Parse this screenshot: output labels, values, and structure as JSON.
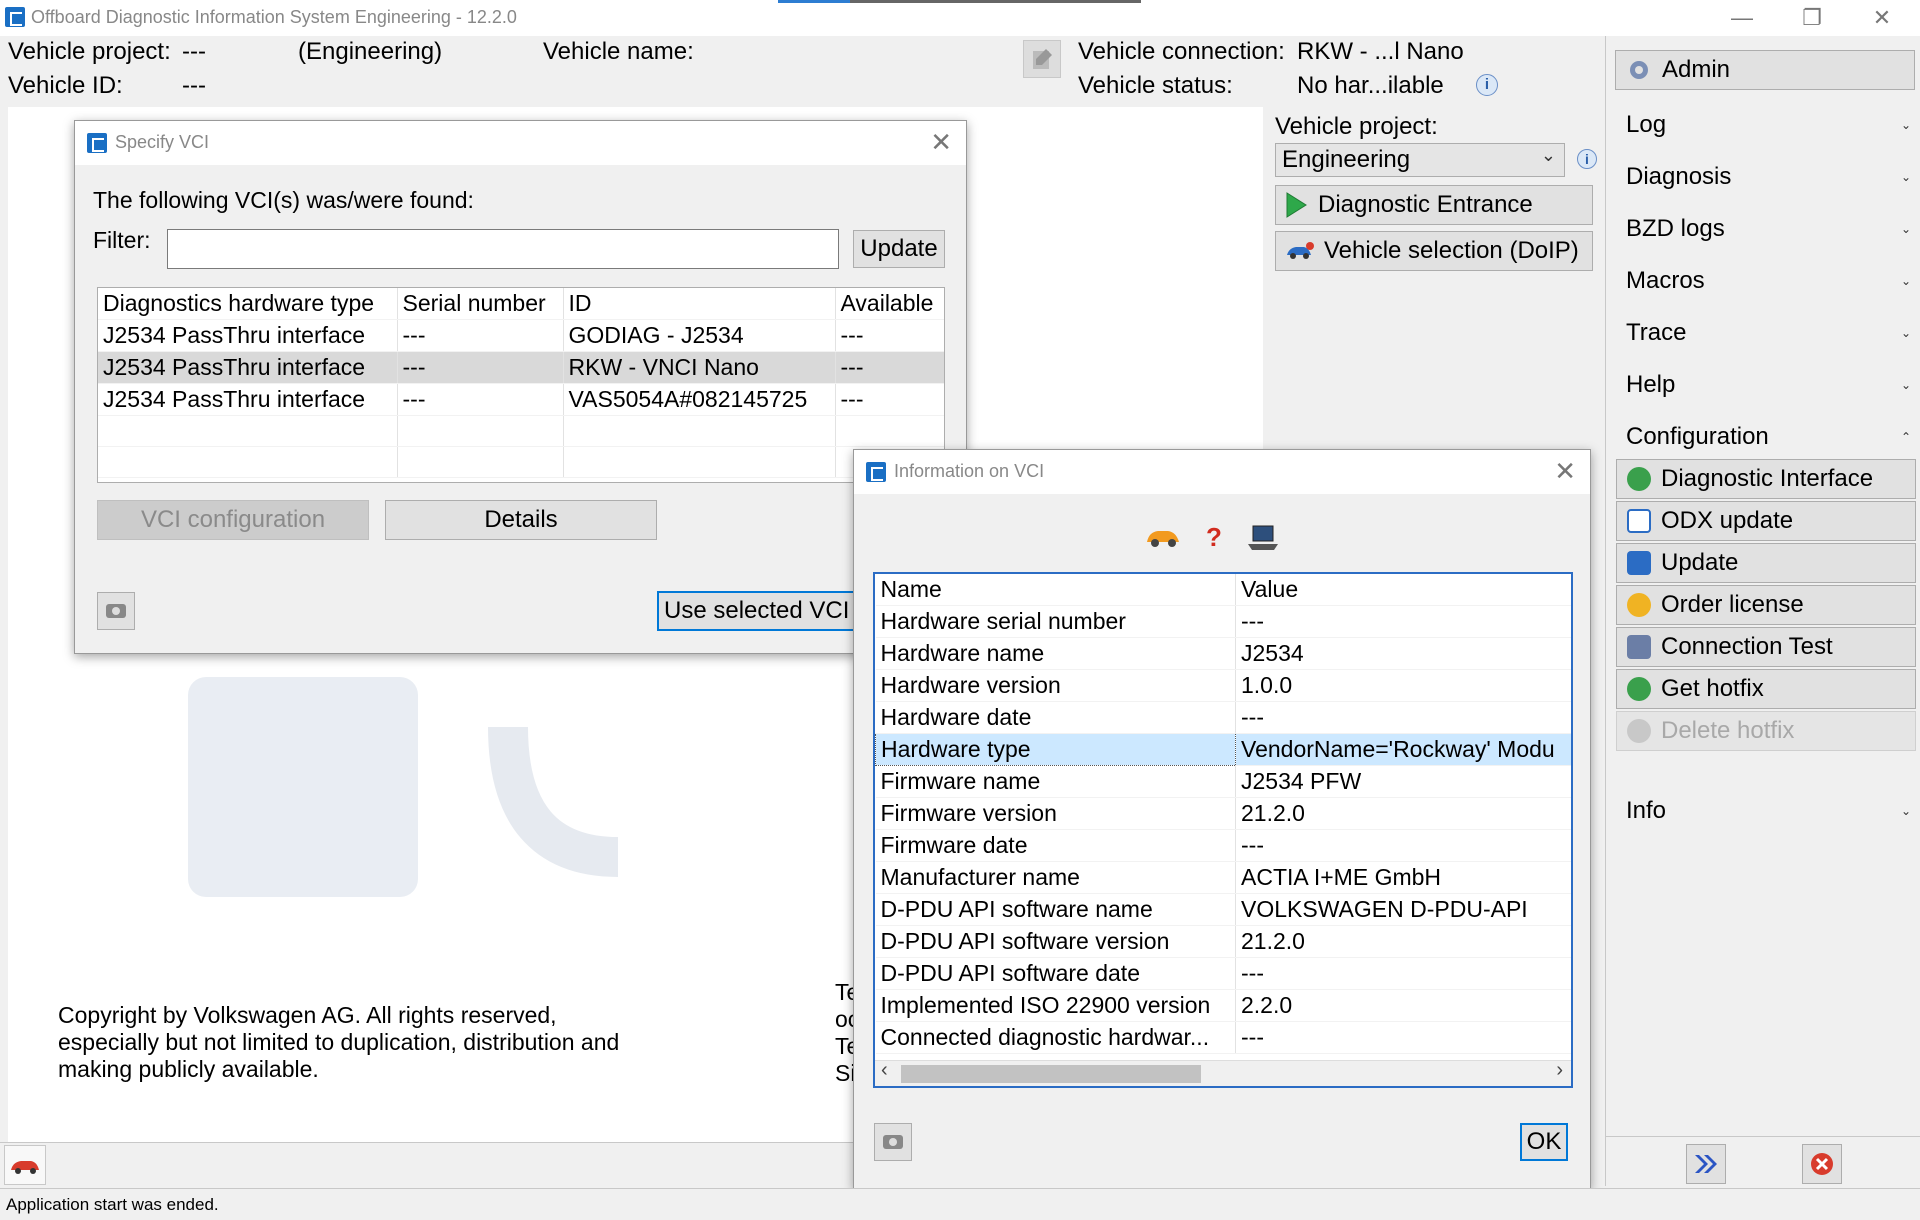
{
  "window": {
    "title": "Offboard Diagnostic Information System Engineering - 12.2.0",
    "controls": [
      "—",
      "❐",
      "✕"
    ]
  },
  "header": {
    "vehicle_project_label": "Vehicle project:",
    "vehicle_project_value": "---",
    "vehicle_project_mode": "(Engineering)",
    "vehicle_name_label": "Vehicle name:",
    "vehicle_id_label": "Vehicle ID:",
    "vehicle_id_value": "---",
    "vehicle_connection_label": "Vehicle connection:",
    "vehicle_connection_value": "RKW - ...l Nano",
    "vehicle_status_label": "Vehicle status:",
    "vehicle_status_value": "No har...ilable"
  },
  "right_panel": {
    "vehicle_project_label": "Vehicle project:",
    "vehicle_project_selected": "Engineering",
    "diagnostic_entrance": "Diagnostic Entrance",
    "vehicle_selection": "Vehicle selection (DoIP)"
  },
  "sidebar": {
    "admin": "Admin",
    "sections": [
      {
        "label": "Log",
        "chevron": "⌄"
      },
      {
        "label": "Diagnosis",
        "chevron": "⌄"
      },
      {
        "label": "BZD logs",
        "chevron": "⌄"
      },
      {
        "label": "Macros",
        "chevron": "⌄"
      },
      {
        "label": "Trace",
        "chevron": "⌄"
      },
      {
        "label": "Help",
        "chevron": "⌄"
      }
    ],
    "configuration": "Configuration",
    "config_items": [
      {
        "label": "Diagnostic Interface",
        "icon": "diagnostic-interface-icon"
      },
      {
        "label": "ODX update",
        "icon": "odx-update-icon"
      },
      {
        "label": "Update",
        "icon": "update-icon"
      },
      {
        "label": "Order license",
        "icon": "order-license-icon"
      },
      {
        "label": "Connection Test",
        "icon": "connection-test-icon"
      },
      {
        "label": "Get hotfix",
        "icon": "get-hotfix-icon"
      },
      {
        "label": "Delete hotfix",
        "icon": "delete-hotfix-icon"
      }
    ],
    "info": "Info"
  },
  "background": {
    "copyright": "Copyright by Volkswagen AG. All rights reserved,\nespecially but not limited to duplication, distribution and\nmaking publicly available.",
    "partial_text": "Te\noc\nTe\nSi"
  },
  "specify_vci": {
    "title": "Specify VCI",
    "found_text": "The following VCI(s) was/were found:",
    "filter_label": "Filter:",
    "filter_value": "",
    "update_button": "Update",
    "columns": [
      "Diagnostics hardware type",
      "Serial number",
      "ID",
      "Available"
    ],
    "rows": [
      [
        "J2534 PassThru interface",
        "---",
        "GODIAG - J2534",
        "---"
      ],
      [
        "J2534 PassThru interface",
        "---",
        "RKW - VNCI Nano",
        "---"
      ],
      [
        "J2534 PassThru interface",
        "---",
        "VAS5054A#082145725",
        "---"
      ]
    ],
    "vci_configuration_button": "VCI configuration",
    "details_button": "Details",
    "use_selected_button": "Use selected VCI"
  },
  "info_vci": {
    "title": "Information on VCI",
    "question_mark": "?",
    "columns": [
      "Name",
      "Value"
    ],
    "rows": [
      [
        "Hardware serial number",
        "---"
      ],
      [
        "Hardware name",
        "J2534"
      ],
      [
        "Hardware version",
        "1.0.0"
      ],
      [
        "Hardware date",
        "---"
      ],
      [
        "Hardware type",
        "VendorName='Rockway' Modu"
      ],
      [
        "Firmware name",
        "J2534 PFW"
      ],
      [
        "Firmware version",
        "21.2.0"
      ],
      [
        "Firmware date",
        "---"
      ],
      [
        "Manufacturer name",
        "ACTIA I+ME GmbH"
      ],
      [
        "D-PDU API software name",
        "VOLKSWAGEN D-PDU-API"
      ],
      [
        "D-PDU API software version",
        "21.2.0"
      ],
      [
        "D-PDU API software date",
        "---"
      ],
      [
        "Implemented ISO 22900 version",
        "2.2.0"
      ],
      [
        "Connected diagnostic hardwar...",
        "---"
      ]
    ],
    "ok_button": "OK"
  },
  "statusbar": {
    "text": "Application start was ended."
  },
  "colors": {
    "accent": "#2d7dd2",
    "selected_row": "#cce8ff",
    "highlight_row": "#d9d9d9",
    "ok_border": "#0078d7"
  }
}
